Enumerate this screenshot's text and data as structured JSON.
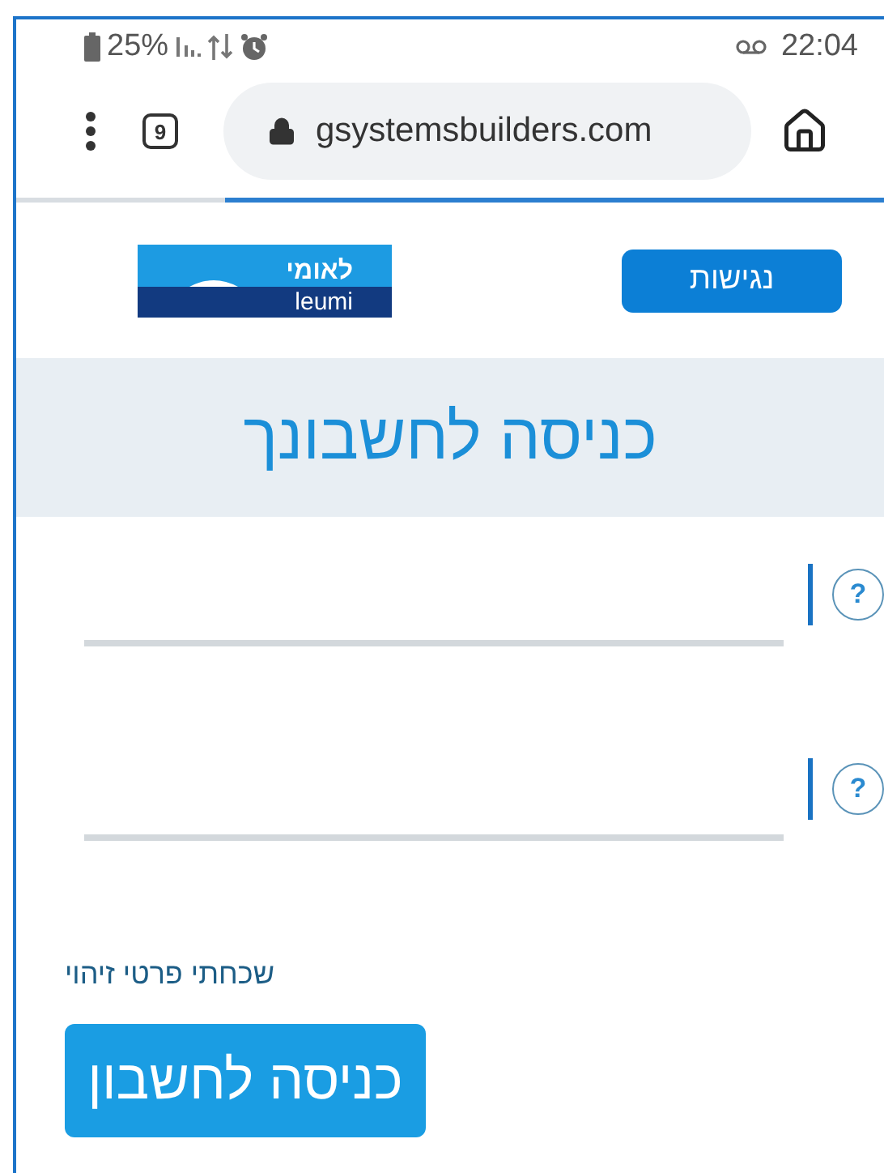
{
  "status_bar": {
    "battery": "25%",
    "time": "22:04"
  },
  "browser": {
    "tab_count": "9",
    "url": "gsystemsbuilders.com",
    "load_bar": {
      "level": 0.76
    }
  },
  "header": {
    "logo_hebrew": "לאומי",
    "logo_latin": "leumi",
    "accessibility_button": "נגישות"
  },
  "title": "כניסה לחשבונך",
  "fields": [
    {
      "kind": "text",
      "help": "?"
    },
    {
      "kind": "text",
      "help": "?"
    }
  ],
  "forgot_link": "שכחתי פרטי זיהוי",
  "submit_button": "כניסה לחשבון"
}
